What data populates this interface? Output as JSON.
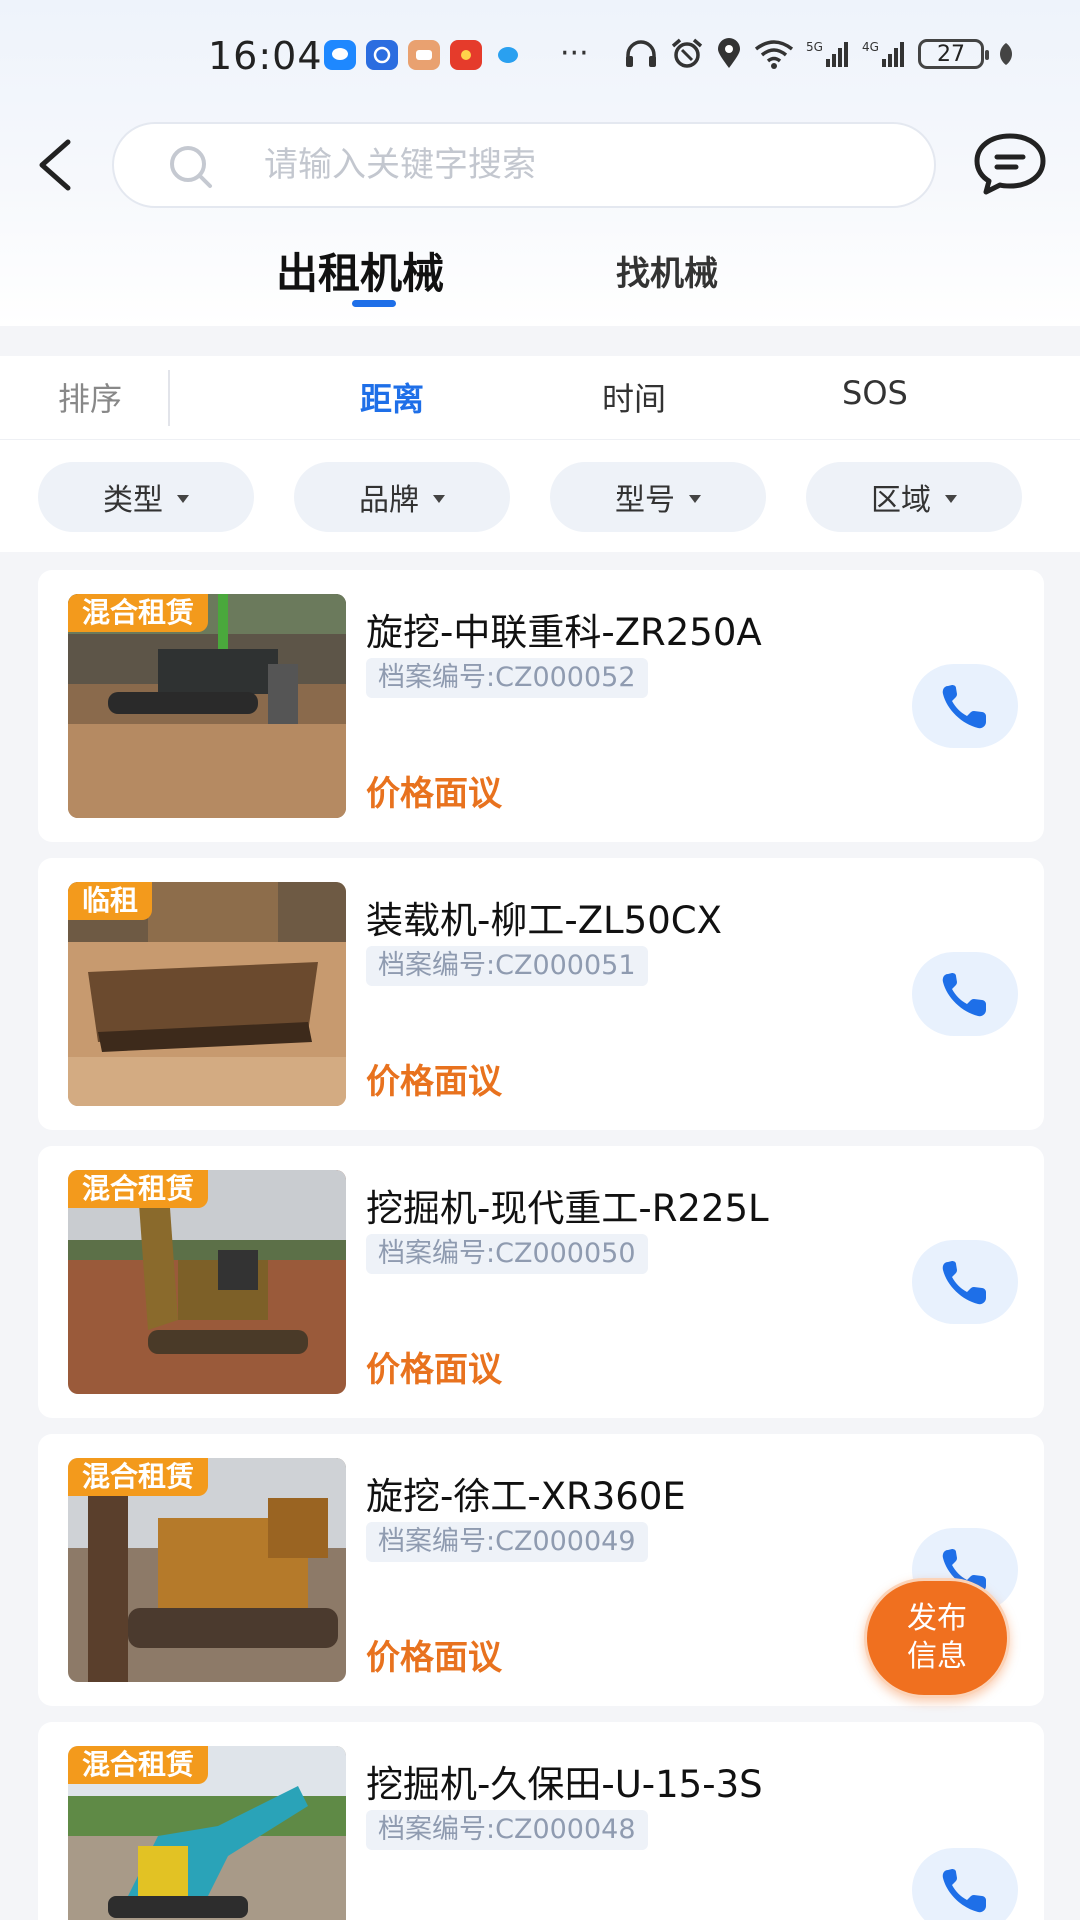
{
  "status_bar": {
    "time": "16:04",
    "battery": "27",
    "network": [
      "5G",
      "4G"
    ],
    "icons": [
      "message-icon",
      "chat-icon",
      "mail-icon",
      "red-packet-icon",
      "bird-icon",
      "more-dots-icon",
      "headphones-icon",
      "alarm-icon",
      "location-icon",
      "wifi-icon",
      "signal-5g-icon",
      "signal-4g-icon",
      "battery-icon",
      "leaf-icon"
    ],
    "more": "···"
  },
  "search": {
    "placeholder": "请输入关键字搜索"
  },
  "main_tabs": [
    {
      "label": "出租机械",
      "active": true
    },
    {
      "label": "找机械",
      "active": false
    }
  ],
  "sort": {
    "label": "排序",
    "options": [
      {
        "label": "距离",
        "active": true
      },
      {
        "label": "时间",
        "active": false
      },
      {
        "label": "SOS",
        "active": false
      }
    ]
  },
  "filters": [
    {
      "label": "类型"
    },
    {
      "label": "品牌"
    },
    {
      "label": "型号"
    },
    {
      "label": "区域"
    }
  ],
  "listings": [
    {
      "tag": "混合租赁",
      "title": "旋挖-中联重科-ZR250A",
      "code": "档案编号:CZ000052",
      "price": "价格面议"
    },
    {
      "tag": "临租",
      "title": "装载机-柳工-ZL50CX",
      "code": "档案编号:CZ000051",
      "price": "价格面议"
    },
    {
      "tag": "混合租赁",
      "title": "挖掘机-现代重工-R225L",
      "code": "档案编号:CZ000050",
      "price": "价格面议"
    },
    {
      "tag": "混合租赁",
      "title": "旋挖-徐工-XR360E",
      "code": "档案编号:CZ000049",
      "price": "价格面议"
    },
    {
      "tag": "混合租赁",
      "title": "挖掘机-久保田-U-15-3S",
      "code": "档案编号:CZ000048",
      "price": ""
    }
  ],
  "fab": {
    "line1": "发布",
    "line2": "信息"
  },
  "colors": {
    "accent": "#1e6fe8",
    "price": "#e8721e",
    "tag": "#f39a1c",
    "fab": "#f0701f"
  }
}
